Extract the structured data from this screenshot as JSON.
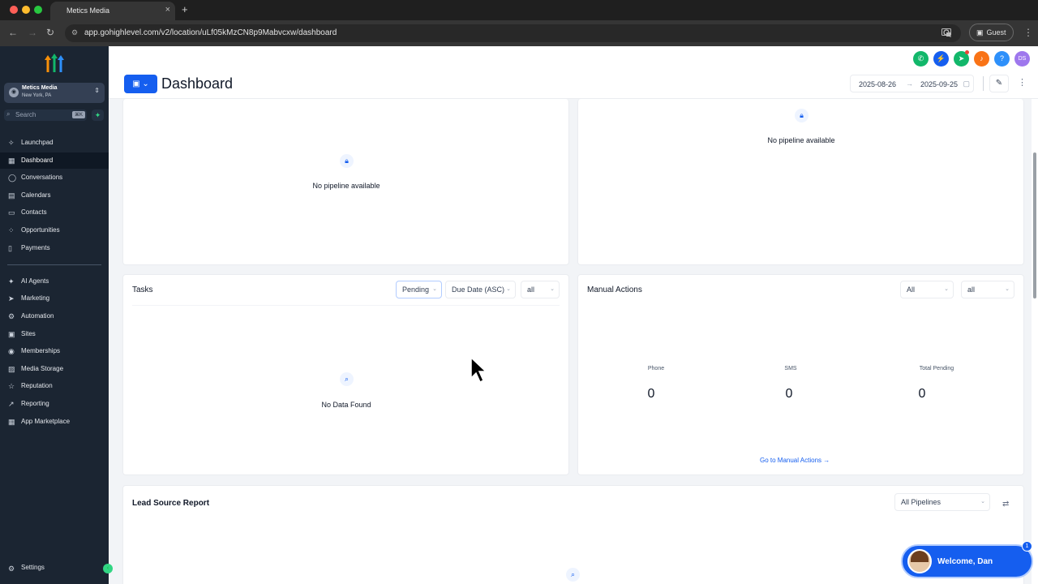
{
  "browser": {
    "tab_title": "Metics Media",
    "tab_close": "×",
    "new_tab": "+",
    "url": "app.gohighlevel.com/v2/location/uLf05kMzCN8p9Mabvcxw/dashboard",
    "profile_label": "Guest",
    "nav_back": "←",
    "nav_forward": "→",
    "nav_reload": "↻",
    "more": "⋮"
  },
  "sidebar": {
    "account": {
      "name": "Metics Media",
      "location": "New York, PA"
    },
    "search_placeholder": "Search",
    "search_shortcut": "⌘K",
    "items": [
      {
        "label": "Launchpad",
        "icon": "rocket-icon",
        "glyph": "✧",
        "active": false
      },
      {
        "label": "Dashboard",
        "icon": "grid-icon",
        "glyph": "▦",
        "active": true
      },
      {
        "label": "Conversations",
        "icon": "chat-icon",
        "glyph": "◯",
        "active": false
      },
      {
        "label": "Calendars",
        "icon": "calendar-icon",
        "glyph": "▤",
        "active": false
      },
      {
        "label": "Contacts",
        "icon": "contact-card-icon",
        "glyph": "▭",
        "active": false
      },
      {
        "label": "Opportunities",
        "icon": "opportunities-icon",
        "glyph": "⁘",
        "active": false
      },
      {
        "label": "Payments",
        "icon": "payments-icon",
        "glyph": "▯",
        "active": false
      }
    ],
    "items2": [
      {
        "label": "AI Agents",
        "icon": "ai-agents-icon",
        "glyph": "✦"
      },
      {
        "label": "Marketing",
        "icon": "megaphone-icon",
        "glyph": "➤"
      },
      {
        "label": "Automation",
        "icon": "automation-icon",
        "glyph": "⚙"
      },
      {
        "label": "Sites",
        "icon": "sites-icon",
        "glyph": "▣"
      },
      {
        "label": "Memberships",
        "icon": "memberships-icon",
        "glyph": "◉"
      },
      {
        "label": "Media Storage",
        "icon": "media-storage-icon",
        "glyph": "▨"
      },
      {
        "label": "Reputation",
        "icon": "star-icon",
        "glyph": "☆"
      },
      {
        "label": "Reporting",
        "icon": "reporting-icon",
        "glyph": "↗"
      },
      {
        "label": "App Marketplace",
        "icon": "marketplace-icon",
        "glyph": "▦"
      }
    ],
    "settings_label": "Settings"
  },
  "header": {
    "title": "Dashboard",
    "date_start": "2025-08-26",
    "date_end": "2025-09-25",
    "date_arrow": "→",
    "avatar_initials": "DS",
    "help": "?"
  },
  "pipeline_left": {
    "empty_text": "No pipeline available"
  },
  "pipeline_right": {
    "empty_text": "No pipeline available"
  },
  "tasks": {
    "title": "Tasks",
    "status_filter": "Pending",
    "sort_filter": "Due Date (ASC)",
    "assignee_filter": "all",
    "empty_text": "No Data Found"
  },
  "manual_actions": {
    "title": "Manual Actions",
    "filter1": "All",
    "filter2": "all",
    "stats": [
      {
        "label": "Phone",
        "value": "0"
      },
      {
        "label": "SMS",
        "value": "0"
      },
      {
        "label": "Total Pending",
        "value": "0"
      }
    ],
    "link_text": "Go to Manual Actions →"
  },
  "lead_source": {
    "title": "Lead Source Report",
    "pipeline_filter": "All Pipelines"
  },
  "welcome": {
    "text": "Welcome, Dan",
    "badge": "1"
  },
  "colors": {
    "accent": "#155eef",
    "sidebar_bg": "#1b2532",
    "phone_green": "#12b76a",
    "notify_orange": "#f97316",
    "avatar_purple": "#9e77ed"
  }
}
